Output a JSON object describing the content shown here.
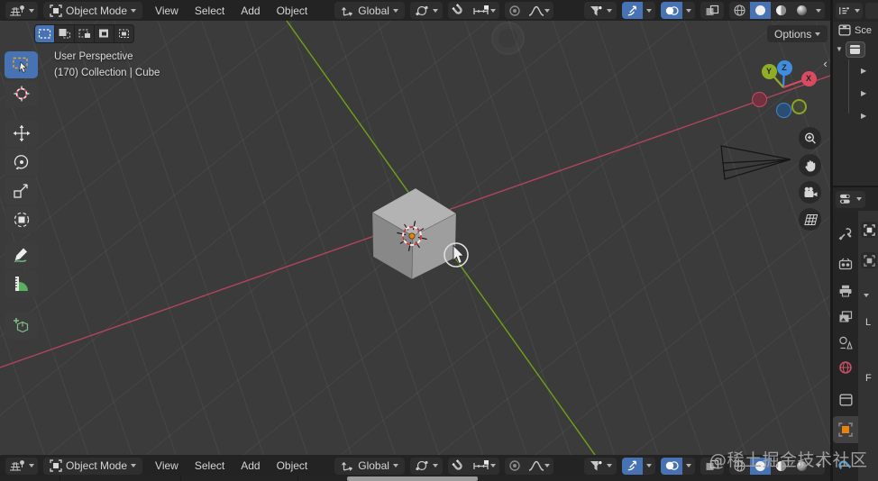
{
  "colors": {
    "accent_blue": "#4772b3",
    "axis_x_red": "#b0455a",
    "axis_y_green": "#70a215",
    "gizmo_x_red": "#d94b63",
    "gizmo_y_green": "#8fae26",
    "gizmo_z_blue": "#3f8edd",
    "object_tab_orange": "#e8830c",
    "cursor_dot_orange": "#e8850c",
    "header_bg": "#232323",
    "panel_bg": "#2b2b2b",
    "viewport_bg": "#3b3b3b",
    "grid_line": "#474747",
    "cube_top": "#b3b3b3",
    "cube_left": "#888888",
    "cube_right": "#9e9e9e",
    "world_icon_red": "#c25065",
    "modifier_icon_blue": "#5a9fd4",
    "annotate_green": "#6fbf80"
  },
  "icons": {
    "chevron_down": "⌄",
    "triangle_down": "▼",
    "triangle_right": "▶",
    "collapse_left": "‹"
  },
  "topbar": {
    "mode_label": "Object Mode",
    "menus": [
      {
        "label": "View"
      },
      {
        "label": "Select"
      },
      {
        "label": "Add"
      },
      {
        "label": "Object"
      }
    ],
    "orientation_label": "Global"
  },
  "tool_settings": {
    "options_label": "Options"
  },
  "viewport": {
    "header_line1": "User Perspective",
    "header_line2": "(170) Collection | Cube",
    "gizmo": {
      "x_label": "X",
      "y_label": "Y",
      "z_label": "Z"
    }
  },
  "outliner": {
    "scene_label": "Sce"
  },
  "properties_panel": {
    "partial_labels": {
      "l": "L",
      "f": "F"
    }
  },
  "watermark": {
    "text": "@稀土掘金技术社区"
  }
}
